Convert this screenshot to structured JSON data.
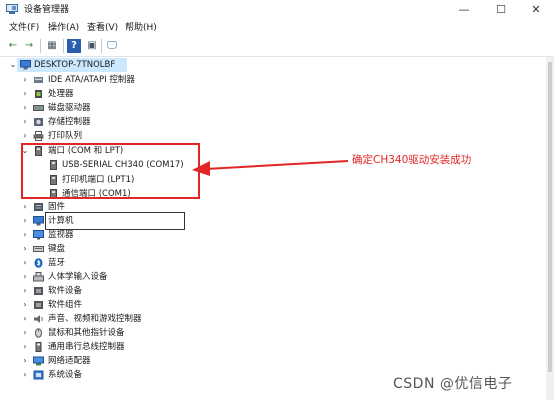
{
  "window": {
    "title": "设备管理器",
    "minimize": "—",
    "maximize": "☐",
    "close": "✕"
  },
  "menu": {
    "file": "文件(F)",
    "action": "操作(A)",
    "view": "查看(V)",
    "help": "帮助(H)"
  },
  "toolbar": {
    "back": "←",
    "forward": "→",
    "properties": "▦",
    "help": "?",
    "update": "▣",
    "monitor": "🖵"
  },
  "tree": {
    "root": "DESKTOP-7TNOLBF",
    "items": [
      "IDE ATA/ATAPI 控制器",
      "处理器",
      "磁盘驱动器",
      "存储控制器",
      "打印队列",
      "端口 (COM 和 LPT)",
      "USB-SERIAL CH340 (COM17)",
      "打印机端口 (LPT1)",
      "通信端口 (COM1)",
      "固件",
      "计算机",
      "监视器",
      "键盘",
      "蓝牙",
      "人体学输入设备",
      "软件设备",
      "软件组件",
      "声音、视频和游戏控制器",
      "鼠标和其他指针设备",
      "通用串行总线控制器",
      "网络适配器",
      "系统设备"
    ]
  },
  "annotation": {
    "text": "确定CH340驱动安装成功",
    "color": "#e32525"
  },
  "watermark": "CSDN @优信电子"
}
